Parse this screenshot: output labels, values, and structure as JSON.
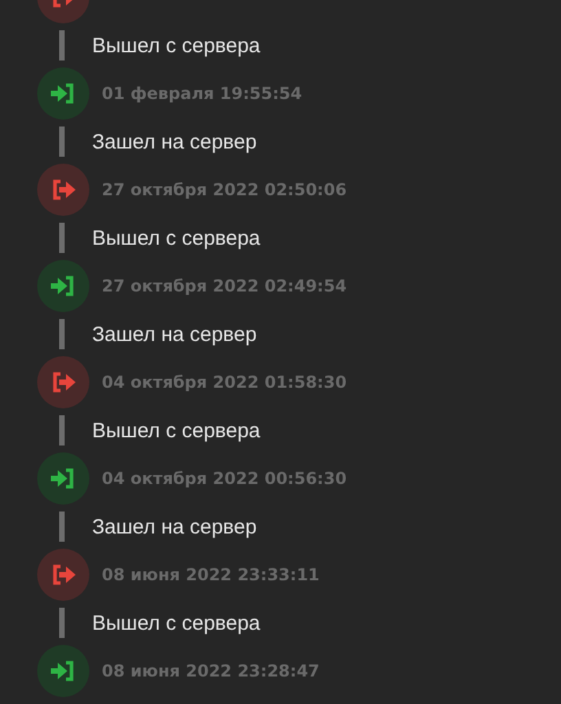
{
  "events": [
    {
      "kind": "exit",
      "message": "Вышел с сервера"
    },
    {
      "kind": "enter",
      "time": "01 февраля 19:55:54",
      "message": "Зашел на сервер"
    },
    {
      "kind": "exit",
      "time": "27 октября 2022 02:50:06",
      "message": "Вышел с сервера"
    },
    {
      "kind": "enter",
      "time": "27 октября 2022 02:49:54",
      "message": "Зашел на сервер"
    },
    {
      "kind": "exit",
      "time": "04 октября 2022 01:58:30",
      "message": "Вышел с сервера"
    },
    {
      "kind": "enter",
      "time": "04 октября 2022 00:56:30",
      "message": "Зашел на сервер"
    },
    {
      "kind": "exit",
      "time": "08 июня 2022 23:33:11",
      "message": "Вышел с сервера"
    },
    {
      "kind": "enter",
      "time": "08 июня 2022 23:28:47"
    }
  ]
}
